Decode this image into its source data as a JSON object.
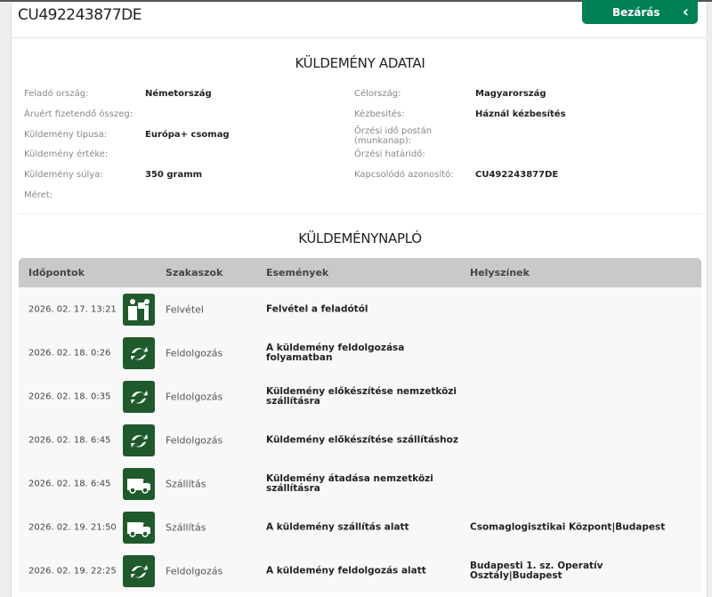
{
  "header": {
    "tracking_number": "CU492243877DE",
    "close_label": "Bezárás",
    "close_icon": "chevron-left-icon"
  },
  "details": {
    "title": "KÜLDEMÉNY ADATAI",
    "left": [
      {
        "label": "Feladó ország:",
        "value": "Németország"
      },
      {
        "label": "Áruért fizetendő összeg:",
        "value": ""
      },
      {
        "label": "Küldemény típusa:",
        "value": "Európa+ csomag"
      },
      {
        "label": "Küldemény értéke:",
        "value": ""
      },
      {
        "label": "Küldemény súlya:",
        "value": "350 gramm"
      },
      {
        "label": "Méret:",
        "value": ""
      }
    ],
    "right": [
      {
        "label": "Célország:",
        "value": "Magyarország"
      },
      {
        "label": "Kézbesítés:",
        "value": "Háznál kézbesítés"
      },
      {
        "label": "Őrzési idő postán (munkanap):",
        "value": ""
      },
      {
        "label": "Őrzési határidő:",
        "value": ""
      },
      {
        "label": "Kapcsolódó azonosító:",
        "value": "CU492243877DE"
      }
    ]
  },
  "log": {
    "title": "KÜLDEMÉNYNAPLÓ",
    "columns": [
      "Időpontok",
      "Szakaszok",
      "Események",
      "Helyszínek"
    ],
    "rows": [
      {
        "date": "2026. 02. 17. 13:21",
        "icon": "pickup-icon",
        "stage": "Felvétel",
        "event": "Felvétel a feladótól",
        "location": ""
      },
      {
        "date": "2026. 02. 18. 0:26",
        "icon": "processing-icon",
        "stage": "Feldolgozás",
        "event": "A küldemény feldolgozása folyamatban",
        "location": ""
      },
      {
        "date": "2026. 02. 18. 0:35",
        "icon": "processing-icon",
        "stage": "Feldolgozás",
        "event": "Küldemény előkészítése nemzetközi szállításra",
        "location": ""
      },
      {
        "date": "2026. 02. 18. 6:45",
        "icon": "processing-icon",
        "stage": "Feldolgozás",
        "event": "Küldemény előkészítése szállításhoz",
        "location": ""
      },
      {
        "date": "2026. 02. 18. 6:45",
        "icon": "van-icon",
        "stage": "Szállítás",
        "event": "Küldemény átadása nemzetközi szállításra",
        "location": ""
      },
      {
        "date": "2026. 02. 19. 21:50",
        "icon": "van-icon",
        "stage": "Szállítás",
        "event": "A küldemény szállítás alatt",
        "location": "Csomaglogisztikai Központ|Budapest"
      },
      {
        "date": "2026. 02. 19. 22:25",
        "icon": "processing-icon",
        "stage": "Feldolgozás",
        "event": "A küldemény feldolgozás alatt",
        "location": "Budapesti 1. sz. Operatív Osztály|Budapest"
      }
    ]
  },
  "colors": {
    "brand": "#008155",
    "icon_bg": "#1e5a2c",
    "table_header": "#c9c9c9"
  }
}
